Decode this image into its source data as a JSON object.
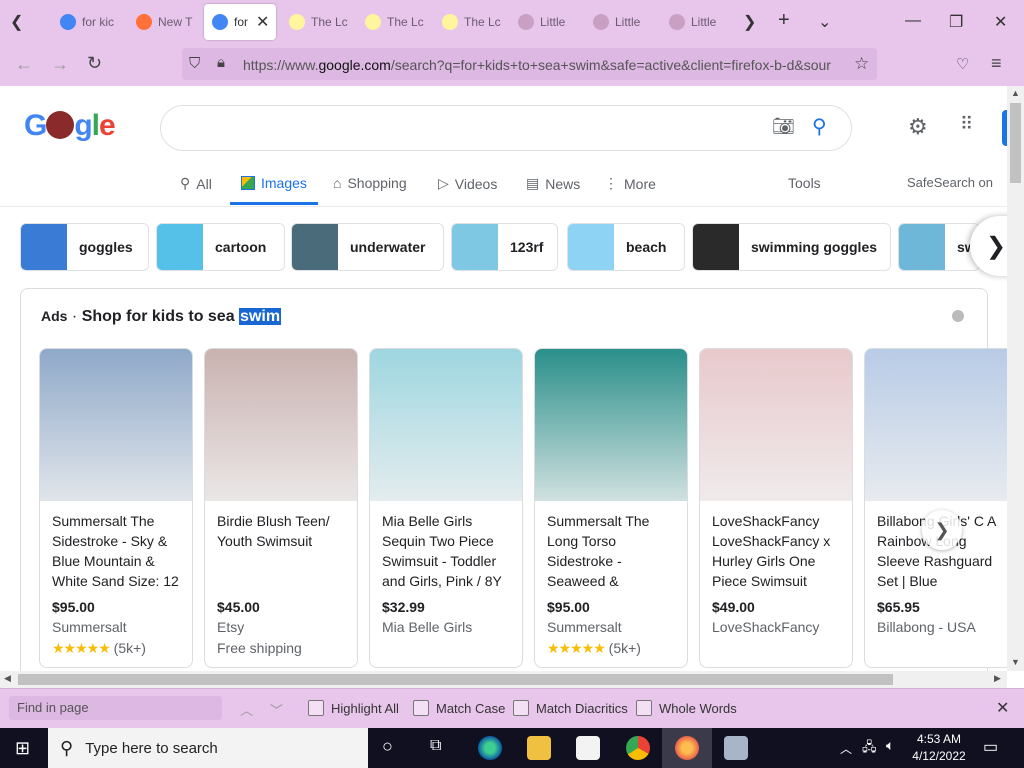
{
  "browser": {
    "tabs": [
      {
        "label": "for kic",
        "fav_color": "#4285f4"
      },
      {
        "label": "New T",
        "fav_color": "#ff7139"
      },
      {
        "label": "for",
        "fav_color": "#4285f4",
        "active": true
      },
      {
        "label": "The Lc",
        "fav_color": "#fff59d"
      },
      {
        "label": "The Lc",
        "fav_color": "#fff59d"
      },
      {
        "label": "The Lc",
        "fav_color": "#fff59d"
      },
      {
        "label": "Little",
        "fav_color": "#c9a0c4"
      },
      {
        "label": "Little",
        "fav_color": "#c9a0c4"
      },
      {
        "label": "Little",
        "fav_color": "#c9a0c4"
      }
    ],
    "close_tab": "✕",
    "url_prefix": "https://www.",
    "url_domain": "google.com",
    "url_rest": "/search?q=for+kids+to+sea+swim&safe=active&client=firefox-b-d&sour"
  },
  "google": {
    "logo": "Google",
    "nav": {
      "all": "All",
      "images": "Images",
      "shopping": "Shopping",
      "videos": "Videos",
      "news": "News",
      "more": "More",
      "tools": "Tools",
      "safesearch": "SafeSearch on"
    },
    "chips": [
      {
        "label": "goggles",
        "color": "#3a7bd5"
      },
      {
        "label": "cartoon",
        "color": "#55c1e8"
      },
      {
        "label": "underwater",
        "color": "#4a6b7a"
      },
      {
        "label": "123rf",
        "color": "#7ec8e3"
      },
      {
        "label": "beach",
        "color": "#8fd3f4"
      },
      {
        "label": "swimming goggles",
        "color": "#2a2a2a"
      },
      {
        "label": "sw",
        "color": "#6fb7d9"
      }
    ],
    "ads": {
      "ads_label": "Ads",
      "sep": "·",
      "title_prefix": "Shop for kids to sea ",
      "title_highlight": "swim"
    },
    "products": [
      {
        "title": "Summersalt The Sidestroke - Sky & Blue Mountain & White Sand Size: 12",
        "price": "$95.00",
        "store": "Summersalt",
        "stars": "★★★★★",
        "extra": "(5k+)",
        "img_color": "#8fa9c9"
      },
      {
        "title": "Birdie Blush Teen/ Youth Swimsuit",
        "price": "$45.00",
        "store": "Etsy",
        "stars": "",
        "extra": "Free shipping",
        "img_color": "#c9b2b0"
      },
      {
        "title": "Mia Belle Girls Sequin Two Piece Swimsuit - Toddler and Girls, Pink / 8Y",
        "price": "$32.99",
        "store": "Mia Belle Girls",
        "stars": "",
        "extra": "",
        "img_color": "#9ed6e0"
      },
      {
        "title": "Summersalt The Long Torso Sidestroke - Seaweed &",
        "price": "$95.00",
        "store": "Summersalt",
        "stars": "★★★★★",
        "extra": "(5k+)",
        "img_color": "#2a8f8a"
      },
      {
        "title": "LoveShackFancy LoveShackFancy x Hurley Girls One Piece Swimsuit",
        "price": "$49.00",
        "store": "LoveShackFancy",
        "stars": "",
        "extra": "",
        "img_color": "#e8c9cc"
      },
      {
        "title": "Billabong Girls' C A Rainbow Long Sleeve Rashguard Set | Blue",
        "price": "$65.95",
        "store": "Billabong - USA",
        "stars": "",
        "extra": "",
        "img_color": "#b8cbe6"
      }
    ]
  },
  "findbar": {
    "placeholder": "Find in page",
    "highlight_all": "Highlight All",
    "match_case": "Match Case",
    "match_diacritics": "Match Diacritics",
    "whole_words": "Whole Words"
  },
  "taskbar": {
    "search_placeholder": "Type here to search",
    "time": "4:53 AM",
    "date": "4/12/2022"
  }
}
